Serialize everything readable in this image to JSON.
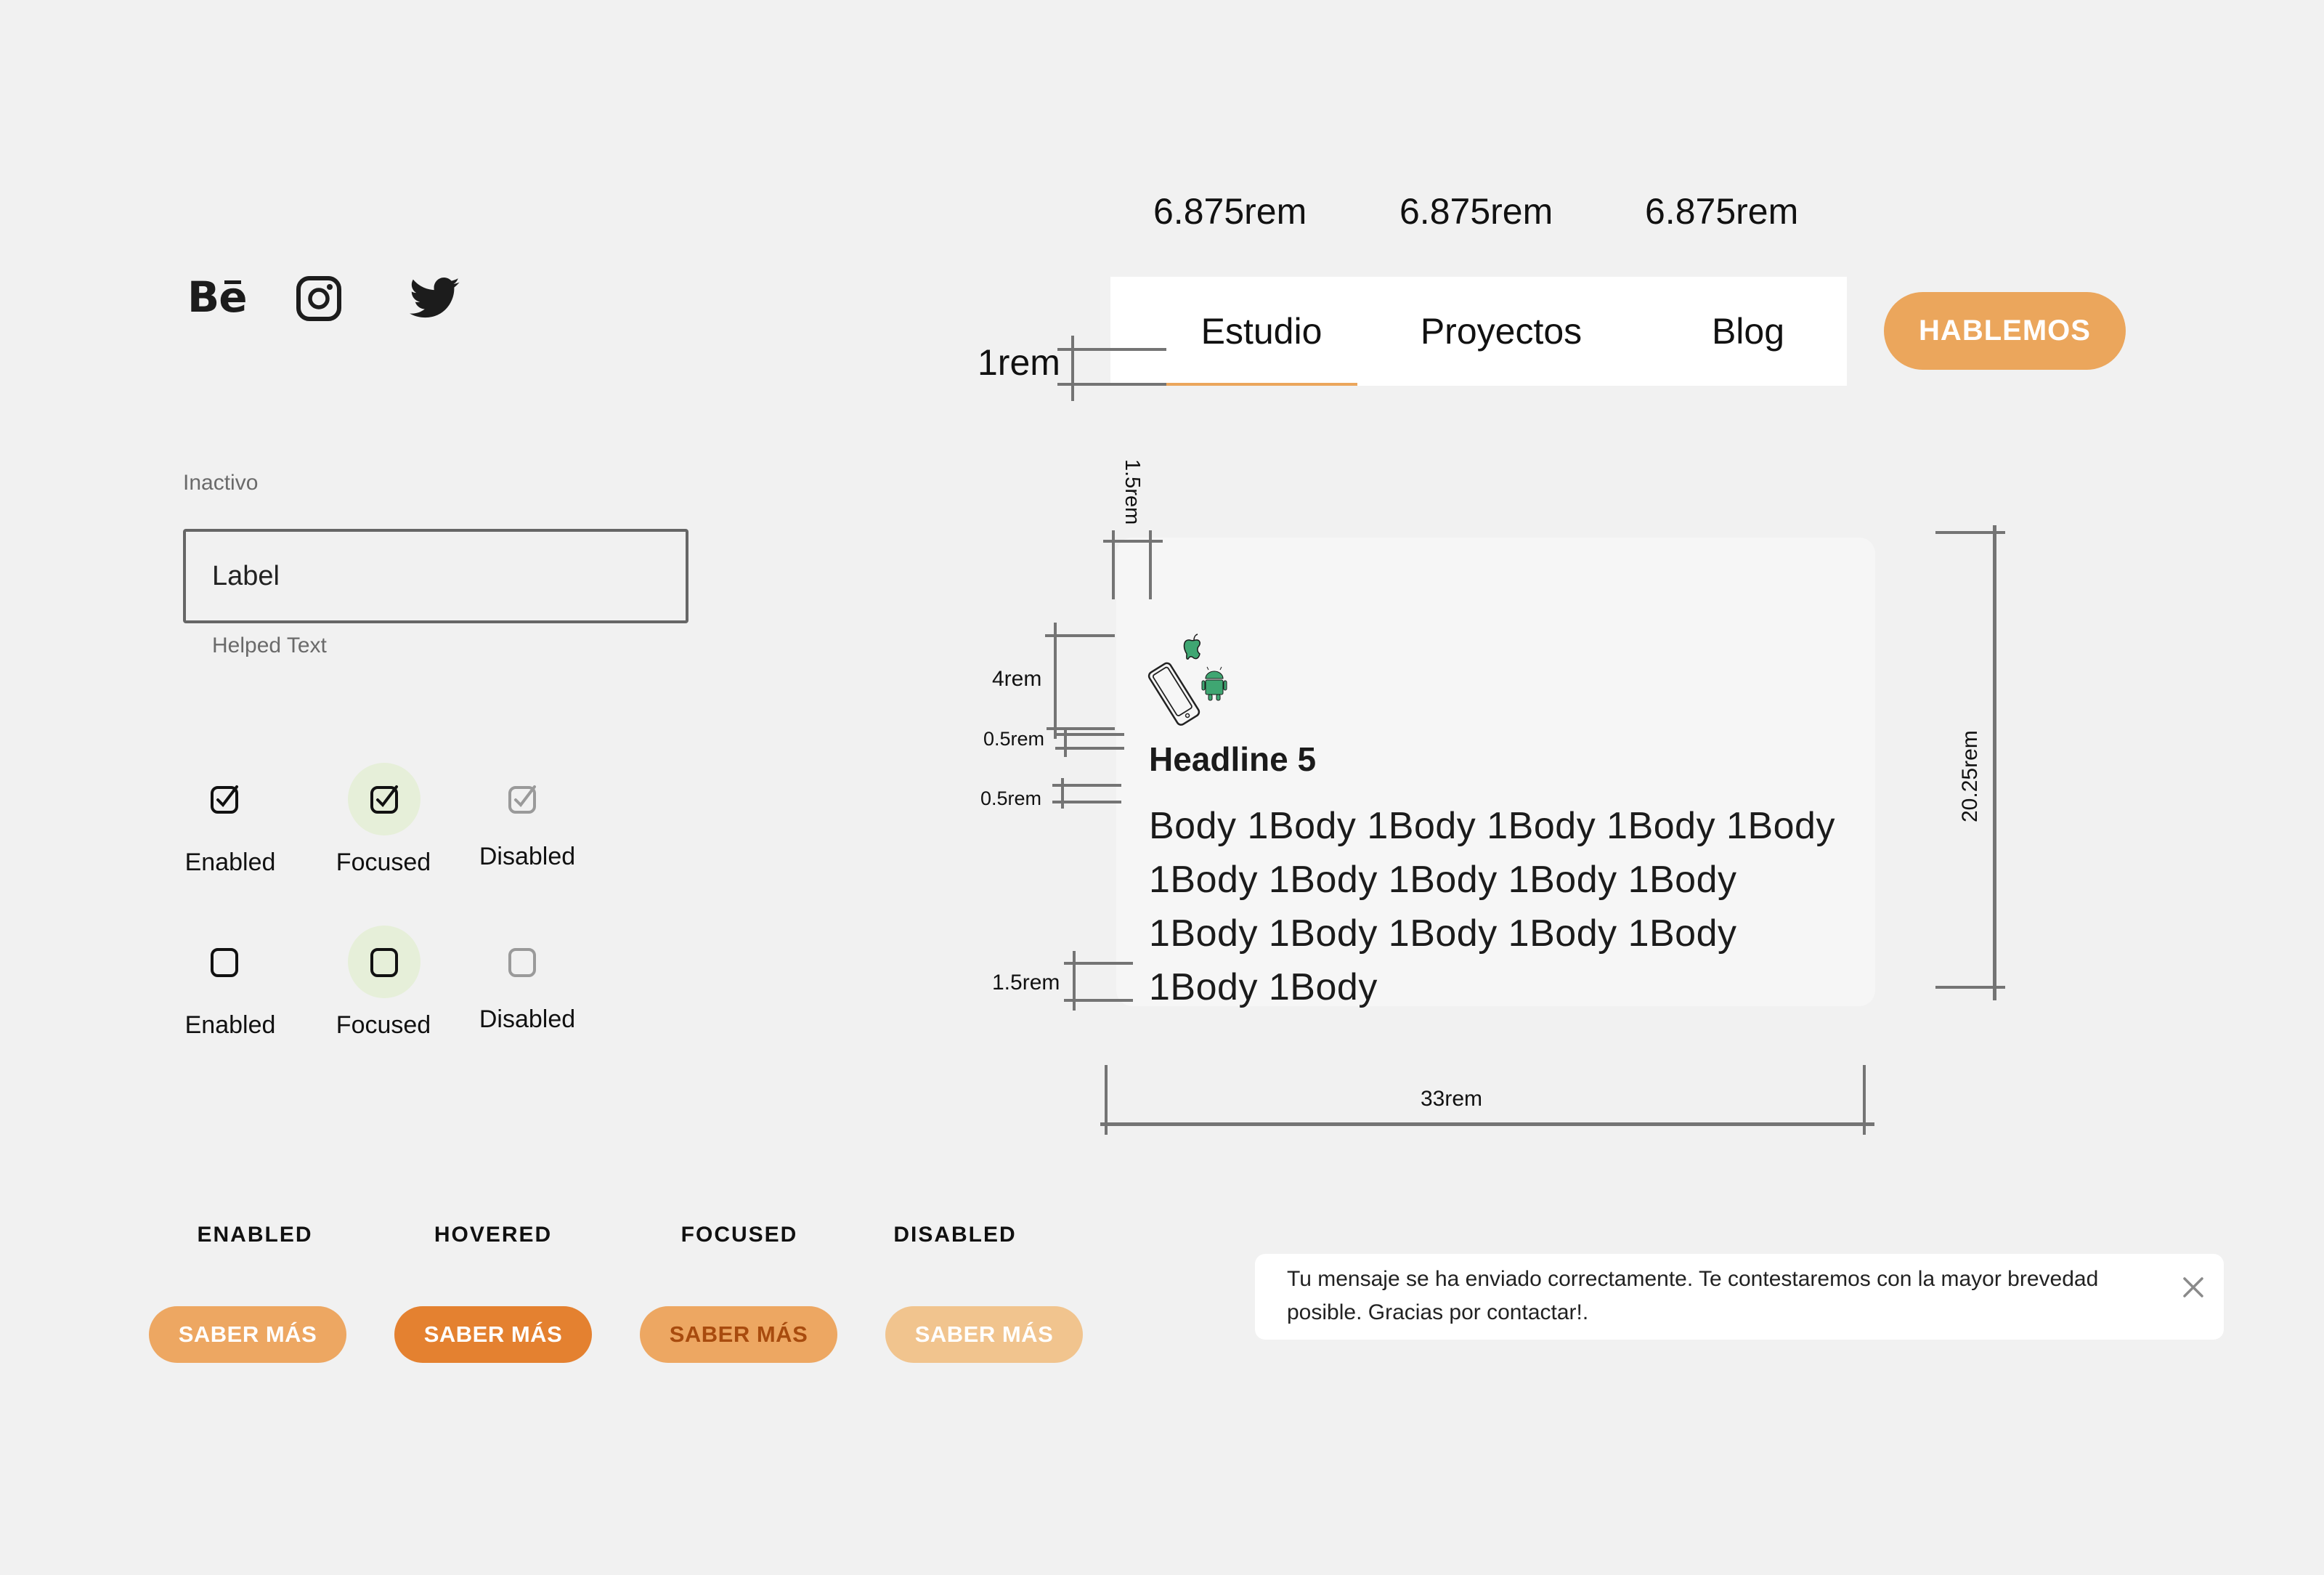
{
  "social": {
    "behance": "Bē",
    "icons": [
      "behance-icon",
      "instagram-icon",
      "twitter-icon"
    ]
  },
  "nav": {
    "widths": [
      "6.875rem",
      "6.875rem",
      "6.875rem"
    ],
    "items": [
      {
        "label": "Estudio",
        "active": true
      },
      {
        "label": "Proyectos",
        "active": false
      },
      {
        "label": "Blog",
        "active": false
      }
    ],
    "cta_label": "HABLEMOS",
    "padding_label": "1rem"
  },
  "input": {
    "state_label": "Inactivo",
    "value": "Label",
    "helper_text": "Helped Text"
  },
  "checkboxes": {
    "rows": [
      [
        {
          "label": "Enabled",
          "checked": true,
          "state": "enabled"
        },
        {
          "label": "Focused",
          "checked": true,
          "state": "focused"
        },
        {
          "label": "Disabled",
          "checked": true,
          "state": "disabled"
        }
      ],
      [
        {
          "label": "Enabled",
          "checked": false,
          "state": "enabled"
        },
        {
          "label": "Focused",
          "checked": false,
          "state": "focused"
        },
        {
          "label": "Disabled",
          "checked": false,
          "state": "disabled"
        }
      ]
    ]
  },
  "card": {
    "headline": "Headline 5",
    "body": "Body 1Body 1Body 1Body 1Body 1Body 1Body 1Body 1Body 1Body 1Body 1Body 1Body 1Body 1Body 1Body 1Body 1Body",
    "dimensions": {
      "top_padding": "1.5rem",
      "icon_height": "4rem",
      "gap_1": "0.5rem",
      "gap_2": "0.5rem",
      "bottom_padding": "1.5rem",
      "height": "20.25rem",
      "width": "33rem"
    }
  },
  "buttons": {
    "states": [
      {
        "state": "ENABLED",
        "label": "SABER MÁS",
        "bg": "#eda762",
        "color": "#ffffff"
      },
      {
        "state": "HOVERED",
        "label": "SABER MÁS",
        "bg": "#e48130",
        "color": "#ffffff"
      },
      {
        "state": "FOCUSED",
        "label": "SABER MÁS",
        "bg": "#eda762",
        "color": "#a84b0e"
      },
      {
        "state": "DISABLED",
        "label": "SABER MÁS",
        "bg": "#f1c48e",
        "color": "#ffffff"
      }
    ]
  },
  "toast": {
    "message": "Tu mensaje se ha enviado correctamente. Te contestaremos con la mayor brevedad posible. Gracias por contactar!.",
    "close_icon": "close-icon"
  },
  "colors": {
    "background": "#f1f1f1",
    "accent": "#eba65c",
    "accent_hover": "#e48130",
    "measure_lines": "#747474",
    "focus_halo": "#e6efd9",
    "platform_green": "#3fa672"
  }
}
